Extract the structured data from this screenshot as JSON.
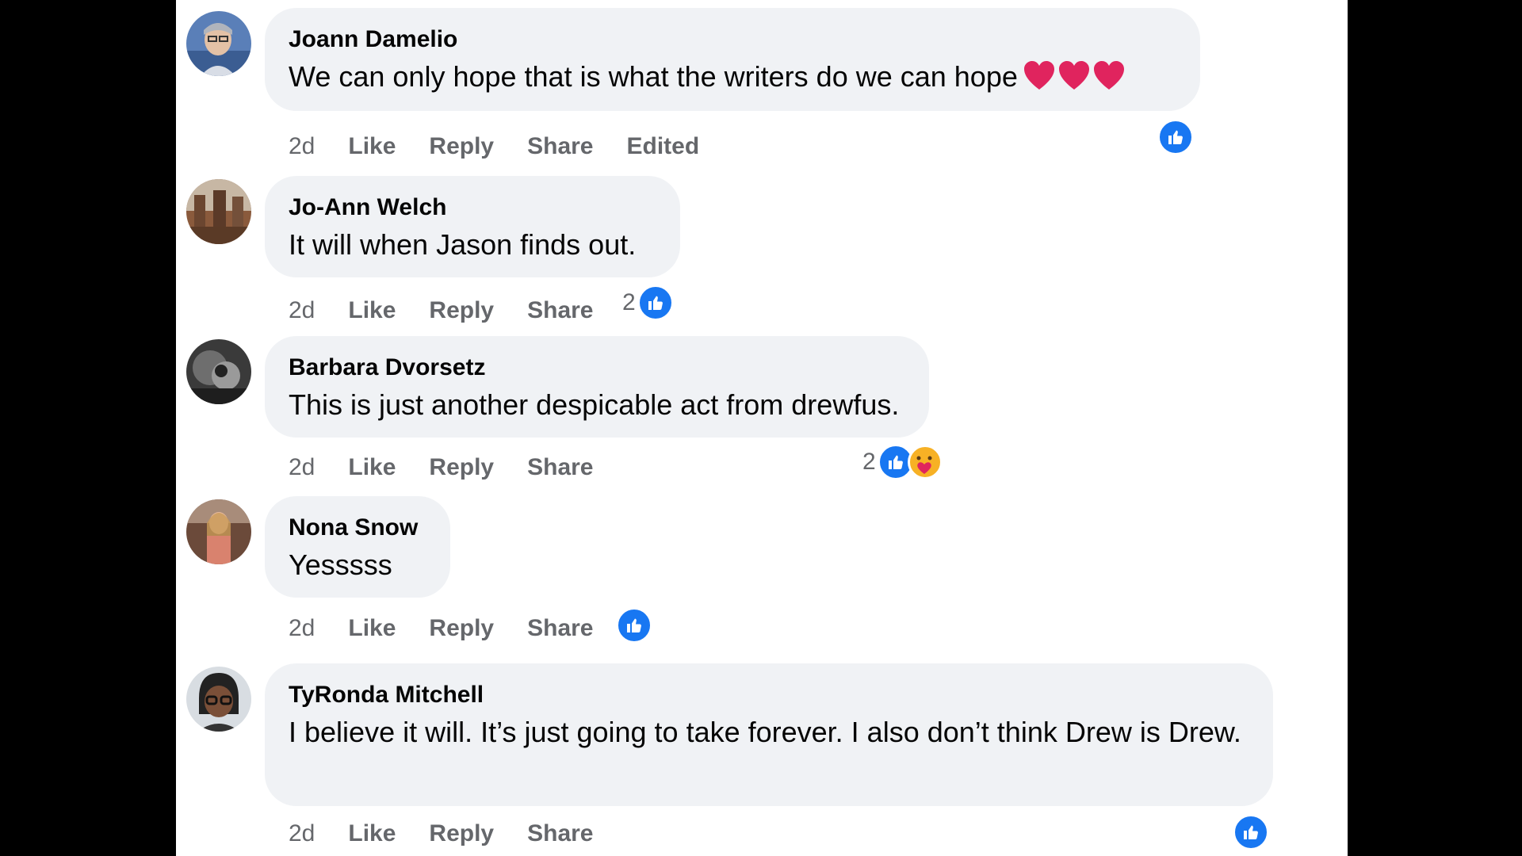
{
  "comments": [
    {
      "author": "Joann Damelio",
      "text": "We can only hope that is what the writers do we can hope",
      "emoji": [
        "red-heart",
        "red-heart",
        "red-heart"
      ],
      "time": "2d",
      "like": "Like",
      "reply": "Reply",
      "share": "Share",
      "edited": "Edited",
      "reactions": [
        "like"
      ]
    },
    {
      "author": "Jo-Ann Welch",
      "text": "It will when Jason finds out.",
      "time": "2d",
      "like": "Like",
      "reply": "Reply",
      "share": "Share",
      "reaction_count": "2",
      "reactions": [
        "like"
      ]
    },
    {
      "author": "Barbara Dvorsetz",
      "text": "This is just another despicable act from drewfus.",
      "time": "2d",
      "like": "Like",
      "reply": "Reply",
      "share": "Share",
      "reaction_count": "2",
      "reactions": [
        "like",
        "care"
      ]
    },
    {
      "author": "Nona Snow",
      "text": "Yesssss",
      "time": "2d",
      "like": "Like",
      "reply": "Reply",
      "share": "Share",
      "reactions": [
        "like"
      ]
    },
    {
      "author": "TyRonda Mitchell",
      "text": "I believe it will. It’s just going to take forever. I also don’t think Drew is Drew.",
      "time": "2d",
      "like": "Like",
      "reply": "Reply",
      "share": "Share",
      "reactions": [
        "like"
      ]
    }
  ],
  "colors": {
    "like_blue": "#1877f2",
    "bubble": "#f0f2f5",
    "meta_gray": "#65676b"
  }
}
